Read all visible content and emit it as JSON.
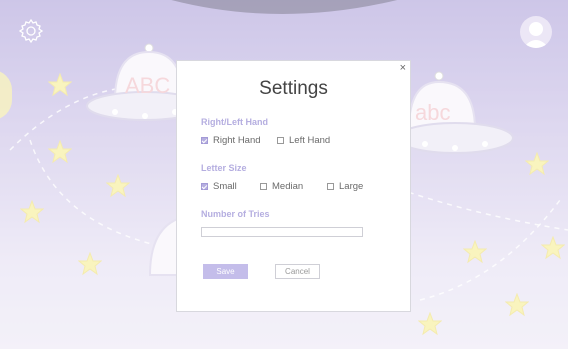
{
  "modal": {
    "title": "Settings",
    "close_label": "×",
    "hand": {
      "label": "Right/Left Hand",
      "options": [
        {
          "label": "Right Hand",
          "checked": true
        },
        {
          "label": "Left Hand",
          "checked": false
        }
      ]
    },
    "letter_size": {
      "label": "Letter Size",
      "options": [
        {
          "label": "Small",
          "checked": true
        },
        {
          "label": "Median",
          "checked": false
        },
        {
          "label": "Large",
          "checked": false
        }
      ]
    },
    "tries": {
      "label": "Number of Tries",
      "value": ""
    },
    "save_label": "Save",
    "cancel_label": "Cancel"
  },
  "background": {
    "ufo_left_text": "ABC",
    "ufo_right_text": "abc"
  },
  "icons": {
    "settings": "gear-icon",
    "profile": "avatar-icon",
    "star": "star-icon"
  },
  "colors": {
    "accent": "#b5aee0",
    "star": "#f6ee9c",
    "background_top": "#b3a8dc"
  }
}
